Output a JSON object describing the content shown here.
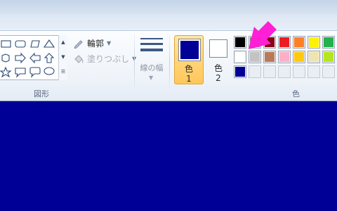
{
  "ribbon": {
    "shapes_group_label": "図形",
    "outline_label": "輪郭",
    "fill_label": "塗りつぶし",
    "line_width_label": "線の幅",
    "color1_label_a": "色",
    "color1_label_b": "1",
    "color2_label_a": "色",
    "color2_label_b": "2",
    "colors_group_label": "色"
  },
  "colors": {
    "color1": "#000096",
    "color2": "#ffffff",
    "arrow": "#ff1fd6",
    "palette": [
      [
        "#000000",
        "#7f7f7f",
        "#880015",
        "#ed1c24",
        "#ff7f27",
        "#fff200",
        "#22b14c"
      ],
      [
        "#ffffff",
        "#c3c3c3",
        "#b97a57",
        "#ffaec9",
        "#ffc90e",
        "#efe4b0",
        "#b5e61d"
      ],
      [
        "#000096",
        "",
        "",
        "",
        "",
        "",
        ""
      ]
    ]
  },
  "icons": {
    "outline": "pencil-outline-icon",
    "fill": "paint-bucket-icon",
    "line_width": "line-width-icon"
  }
}
